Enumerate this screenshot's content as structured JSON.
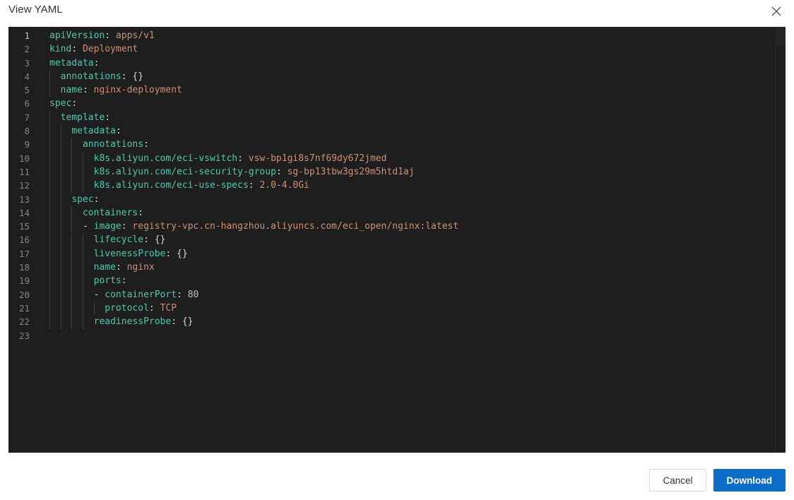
{
  "dialog": {
    "title": "View YAML",
    "close_icon": "close-icon"
  },
  "editor": {
    "language": "yaml",
    "theme_background": "#1e1e1e",
    "line_count": 23,
    "lines": [
      {
        "num": "1",
        "indent": 0,
        "tokens": [
          {
            "t": "k",
            "s": "apiVersion"
          },
          {
            "t": "p",
            "s": ": "
          },
          {
            "t": "v",
            "s": "apps/v1"
          }
        ]
      },
      {
        "num": "2",
        "indent": 0,
        "tokens": [
          {
            "t": "k",
            "s": "kind"
          },
          {
            "t": "p",
            "s": ": "
          },
          {
            "t": "v",
            "s": "Deployment"
          }
        ]
      },
      {
        "num": "3",
        "indent": 0,
        "tokens": [
          {
            "t": "k",
            "s": "metadata"
          },
          {
            "t": "p",
            "s": ":"
          }
        ]
      },
      {
        "num": "4",
        "indent": 1,
        "tokens": [
          {
            "t": "p",
            "s": "  "
          },
          {
            "t": "k",
            "s": "annotations"
          },
          {
            "t": "p",
            "s": ": {}"
          }
        ]
      },
      {
        "num": "5",
        "indent": 1,
        "tokens": [
          {
            "t": "p",
            "s": "  "
          },
          {
            "t": "k",
            "s": "name"
          },
          {
            "t": "p",
            "s": ": "
          },
          {
            "t": "v",
            "s": "nginx-deployment"
          }
        ]
      },
      {
        "num": "6",
        "indent": 0,
        "tokens": [
          {
            "t": "k",
            "s": "spec"
          },
          {
            "t": "p",
            "s": ":"
          }
        ]
      },
      {
        "num": "7",
        "indent": 1,
        "tokens": [
          {
            "t": "p",
            "s": "  "
          },
          {
            "t": "k",
            "s": "template"
          },
          {
            "t": "p",
            "s": ":"
          }
        ]
      },
      {
        "num": "8",
        "indent": 2,
        "tokens": [
          {
            "t": "p",
            "s": "    "
          },
          {
            "t": "k",
            "s": "metadata"
          },
          {
            "t": "p",
            "s": ":"
          }
        ]
      },
      {
        "num": "9",
        "indent": 3,
        "tokens": [
          {
            "t": "p",
            "s": "      "
          },
          {
            "t": "k",
            "s": "annotations"
          },
          {
            "t": "p",
            "s": ":"
          }
        ]
      },
      {
        "num": "10",
        "indent": 4,
        "tokens": [
          {
            "t": "p",
            "s": "        "
          },
          {
            "t": "k",
            "s": "k8s.aliyun.com/eci-vswitch"
          },
          {
            "t": "p",
            "s": ": "
          },
          {
            "t": "v",
            "s": "vsw-bp1gi8s7nf69dy672jmed"
          }
        ]
      },
      {
        "num": "11",
        "indent": 4,
        "tokens": [
          {
            "t": "p",
            "s": "        "
          },
          {
            "t": "k",
            "s": "k8s.aliyun.com/eci-security-group"
          },
          {
            "t": "p",
            "s": ": "
          },
          {
            "t": "v",
            "s": "sg-bp13tbw3gs29m5htd1aj"
          }
        ]
      },
      {
        "num": "12",
        "indent": 4,
        "tokens": [
          {
            "t": "p",
            "s": "        "
          },
          {
            "t": "k",
            "s": "k8s.aliyun.com/eci-use-specs"
          },
          {
            "t": "p",
            "s": ": "
          },
          {
            "t": "v",
            "s": "2.0-4.0Gi"
          }
        ]
      },
      {
        "num": "13",
        "indent": 2,
        "tokens": [
          {
            "t": "p",
            "s": "    "
          },
          {
            "t": "k",
            "s": "spec"
          },
          {
            "t": "p",
            "s": ":"
          }
        ]
      },
      {
        "num": "14",
        "indent": 3,
        "tokens": [
          {
            "t": "p",
            "s": "      "
          },
          {
            "t": "k",
            "s": "containers"
          },
          {
            "t": "p",
            "s": ":"
          }
        ]
      },
      {
        "num": "15",
        "indent": 3,
        "tokens": [
          {
            "t": "p",
            "s": "      - "
          },
          {
            "t": "k",
            "s": "image"
          },
          {
            "t": "p",
            "s": ": "
          },
          {
            "t": "v",
            "s": "registry-vpc.cn-hangzhou.aliyuncs.com/eci_open/nginx:latest"
          }
        ]
      },
      {
        "num": "16",
        "indent": 4,
        "tokens": [
          {
            "t": "p",
            "s": "        "
          },
          {
            "t": "k",
            "s": "lifecycle"
          },
          {
            "t": "p",
            "s": ": {}"
          }
        ]
      },
      {
        "num": "17",
        "indent": 4,
        "tokens": [
          {
            "t": "p",
            "s": "        "
          },
          {
            "t": "k",
            "s": "livenessProbe"
          },
          {
            "t": "p",
            "s": ": {}"
          }
        ]
      },
      {
        "num": "18",
        "indent": 4,
        "tokens": [
          {
            "t": "p",
            "s": "        "
          },
          {
            "t": "k",
            "s": "name"
          },
          {
            "t": "p",
            "s": ": "
          },
          {
            "t": "v",
            "s": "nginx"
          }
        ]
      },
      {
        "num": "19",
        "indent": 4,
        "tokens": [
          {
            "t": "p",
            "s": "        "
          },
          {
            "t": "k",
            "s": "ports"
          },
          {
            "t": "p",
            "s": ":"
          }
        ]
      },
      {
        "num": "20",
        "indent": 4,
        "tokens": [
          {
            "t": "p",
            "s": "        - "
          },
          {
            "t": "k",
            "s": "containerPort"
          },
          {
            "t": "p",
            "s": ": "
          },
          {
            "t": "n",
            "s": "80"
          }
        ]
      },
      {
        "num": "21",
        "indent": 5,
        "tokens": [
          {
            "t": "p",
            "s": "          "
          },
          {
            "t": "k",
            "s": "protocol"
          },
          {
            "t": "p",
            "s": ": "
          },
          {
            "t": "v",
            "s": "TCP"
          }
        ]
      },
      {
        "num": "22",
        "indent": 4,
        "tokens": [
          {
            "t": "p",
            "s": "        "
          },
          {
            "t": "k",
            "s": "readinessProbe"
          },
          {
            "t": "p",
            "s": ": {}"
          }
        ]
      },
      {
        "num": "23",
        "indent": 0,
        "tokens": []
      }
    ]
  },
  "footer": {
    "cancel_label": "Cancel",
    "download_label": "Download",
    "primary_color": "#0c6dc7"
  }
}
